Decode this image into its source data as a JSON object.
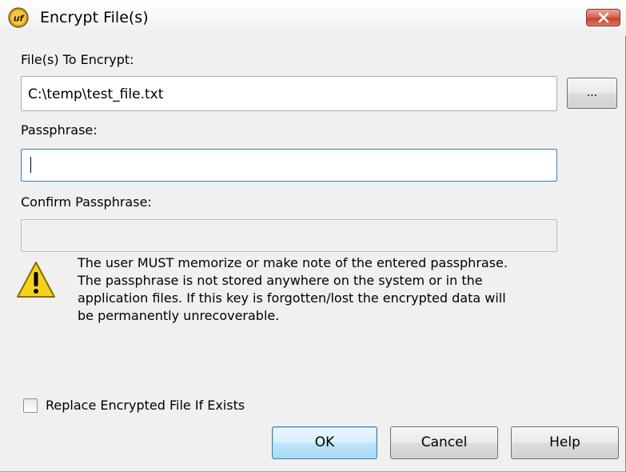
{
  "window": {
    "title": "Encrypt File(s)",
    "app_icon": "uf-logo-icon",
    "close_icon": "close-icon"
  },
  "files": {
    "label": "File(s) To Encrypt:",
    "value": "C:\\temp\\test_file.txt",
    "browse_label": "..."
  },
  "passphrase": {
    "label": "Passphrase:",
    "value": ""
  },
  "confirm": {
    "label": "Confirm Passphrase:",
    "value": ""
  },
  "warning": {
    "icon": "warning-icon",
    "lines": [
      "The user MUST memorize or make note of the entered passphrase.",
      "The passphrase is not stored anywhere on the system or in the",
      "application files.  If this key is forgotten/lost the encrypted data will",
      "be permanently unrecoverable."
    ]
  },
  "replace_option": {
    "label": "Replace Encrypted File If Exists",
    "checked": false
  },
  "buttons": {
    "ok": "OK",
    "cancel": "Cancel",
    "help": "Help"
  },
  "colors": {
    "focus_border": "#3c7fb1",
    "close_button": "#c4442c",
    "warning_yellow": "#f5d31c"
  }
}
